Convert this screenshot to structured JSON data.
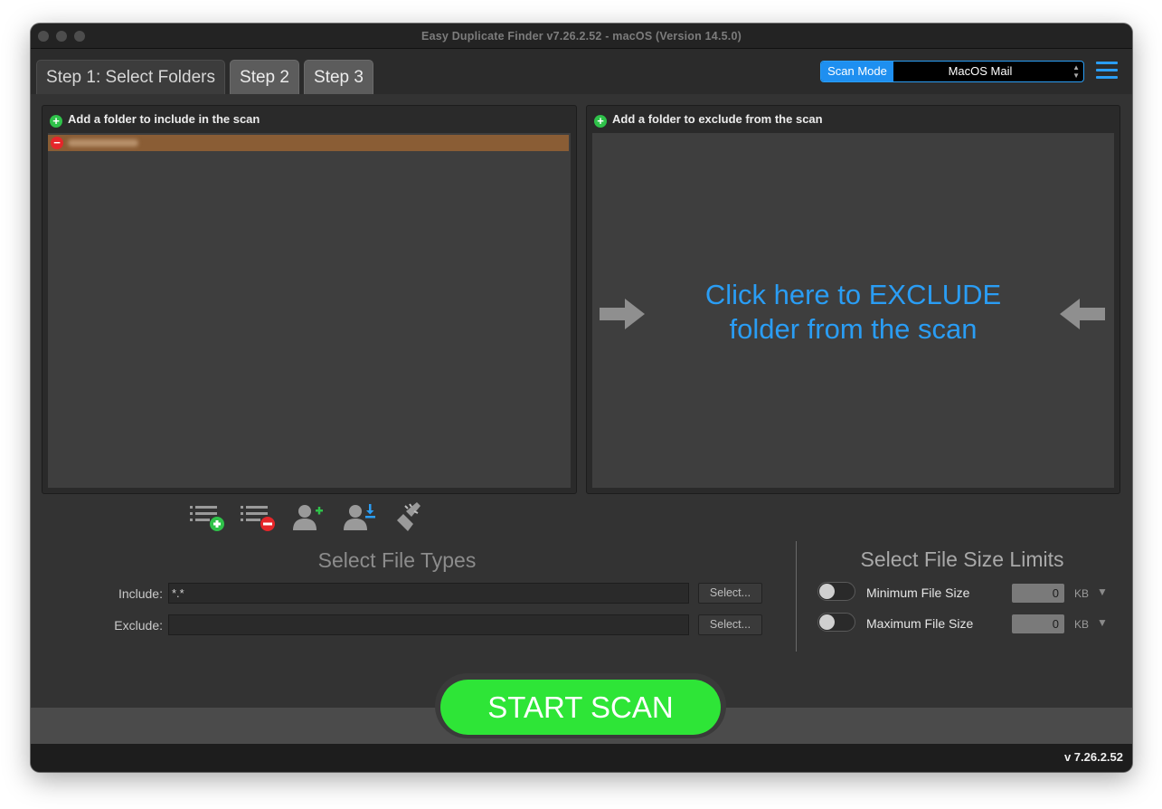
{
  "window": {
    "title": "Easy Duplicate Finder v7.26.2.52 - macOS (Version 14.5.0)"
  },
  "tabs": [
    {
      "label": "Step 1: Select Folders",
      "active": true
    },
    {
      "label": "Step 2",
      "active": false
    },
    {
      "label": "Step 3",
      "active": false
    }
  ],
  "scan_mode": {
    "label": "Scan Mode",
    "value": "MacOS Mail",
    "accent": "#1e8ff0"
  },
  "include_panel": {
    "heading": "Add a folder to include in the scan",
    "folder_selected_color": "#8a5d35"
  },
  "exclude_panel": {
    "heading": "Add a folder to exclude from the scan",
    "message_line1": "Click here to EXCLUDE",
    "message_line2": "folder from the scan"
  },
  "toolbar_icons": [
    "add-list-icon",
    "remove-list-icon",
    "add-user-icon",
    "import-user-icon",
    "clean-brush-icon"
  ],
  "file_types": {
    "title": "Select File Types",
    "include_label": "Include:",
    "include_value": "*.*",
    "exclude_label": "Exclude:",
    "exclude_value": "",
    "select_label": "Select..."
  },
  "file_size": {
    "title": "Select File Size Limits",
    "min_label": "Minimum File Size",
    "min_value": "0",
    "max_label": "Maximum File Size",
    "max_value": "0",
    "unit": "KB"
  },
  "start_scan": {
    "label": "START SCAN",
    "color": "#2ee537"
  },
  "status": {
    "version": "v 7.26.2.52"
  }
}
